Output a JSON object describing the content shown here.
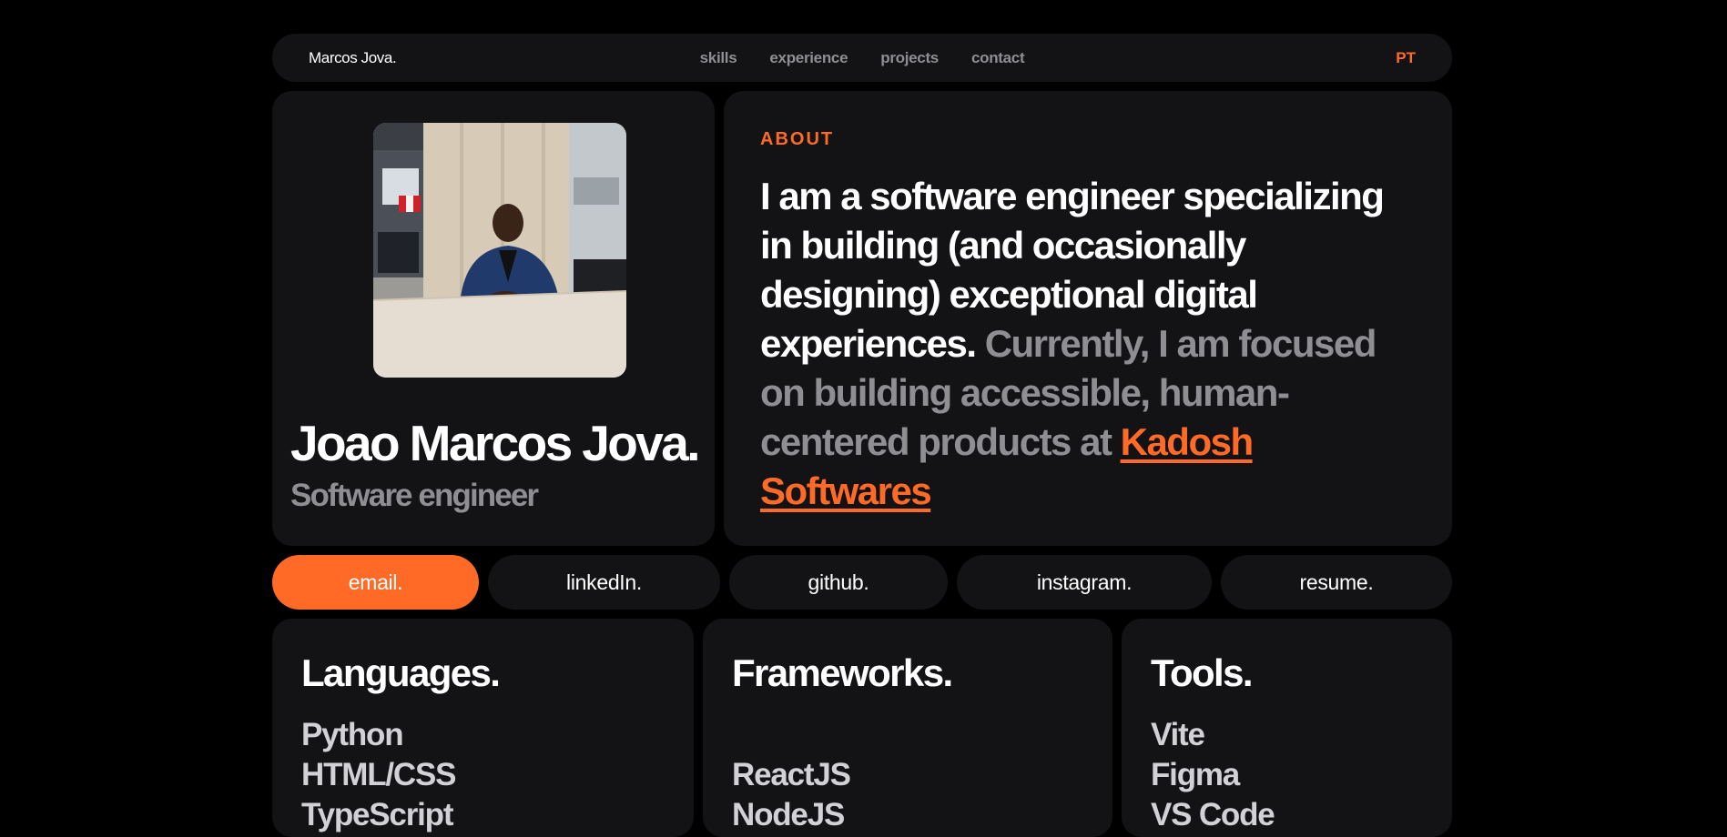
{
  "nav": {
    "brand": "Marcos Jova.",
    "links": [
      "skills",
      "experience",
      "projects",
      "contact"
    ],
    "lang": "PT"
  },
  "profile": {
    "name": "Joao Marcos Jova.",
    "role": "Software engineer"
  },
  "about": {
    "label": "ABOUT",
    "intro": "I am a software engineer specializing in building (and occasionally designing) exceptional digital experiences.",
    "focus": "Currently, I am focused on building accessible, human-centered products at",
    "company": "Kadosh Softwares"
  },
  "social": [
    {
      "label": "email.",
      "active": true
    },
    {
      "label": "linkedIn.",
      "active": false
    },
    {
      "label": "github.",
      "active": false
    },
    {
      "label": "instagram.",
      "active": false
    },
    {
      "label": "resume.",
      "active": false
    }
  ],
  "skills": {
    "languages": {
      "title": "Languages.",
      "items": [
        "Python",
        "HTML/CSS",
        "TypeScript"
      ]
    },
    "frameworks": {
      "title": "Frameworks.",
      "items": [
        "ReactJS",
        "NodeJS"
      ]
    },
    "tools": {
      "title": "Tools.",
      "items": [
        "Vite",
        "Figma",
        "VS Code"
      ]
    }
  },
  "colors": {
    "accent": "#ff6b26",
    "card": "#131315",
    "muted": "#8e8e93",
    "background": "#000000"
  }
}
